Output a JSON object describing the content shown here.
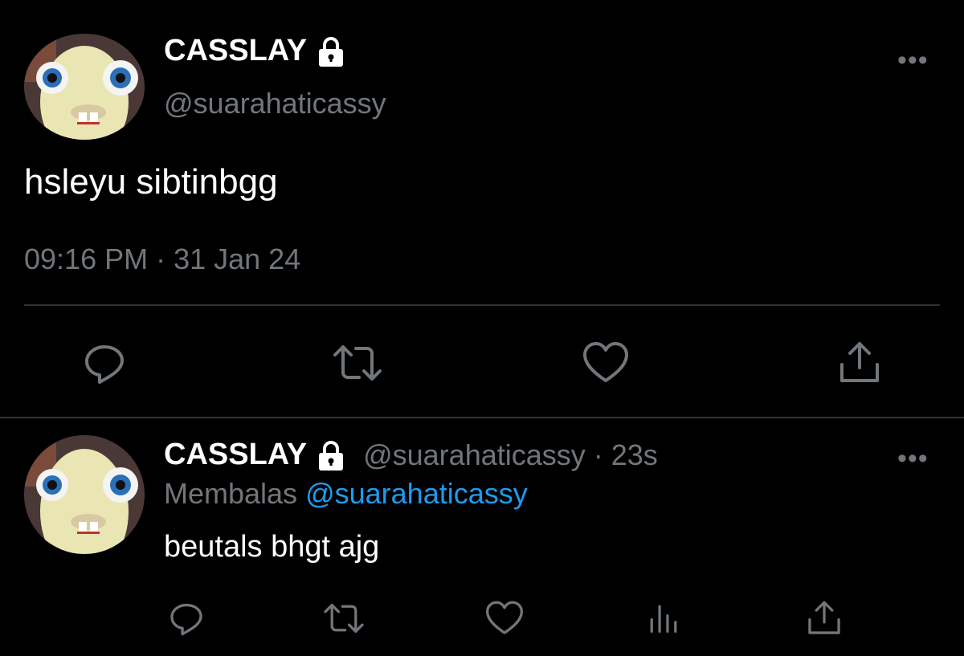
{
  "main_tweet": {
    "display_name": "CASSLAY",
    "handle": "@suarahaticassy",
    "text": "hsleyu sibtinbgg",
    "timestamp": "09:16 PM · 31 Jan 24",
    "more_label": "•••",
    "lock_icon": "lock-icon",
    "actions": [
      "reply-icon",
      "retweet-icon",
      "like-icon",
      "share-icon"
    ]
  },
  "reply_tweet": {
    "display_name": "CASSLAY",
    "handle": "@suarahaticassy",
    "separator": "·",
    "time_ago": "23s",
    "replying_prefix": "Membalas",
    "replying_to": "@suarahaticassy",
    "text": "beutals bhgt ajg",
    "more_label": "•••",
    "lock_icon": "lock-icon",
    "actions": [
      "reply-icon",
      "retweet-icon",
      "like-icon",
      "analytics-icon",
      "share-icon"
    ]
  },
  "colors": {
    "background": "#000000",
    "primary_text": "#ffffff",
    "secondary_text": "#71767b",
    "accent": "#1d9bf0",
    "divider": "#2f3336"
  }
}
